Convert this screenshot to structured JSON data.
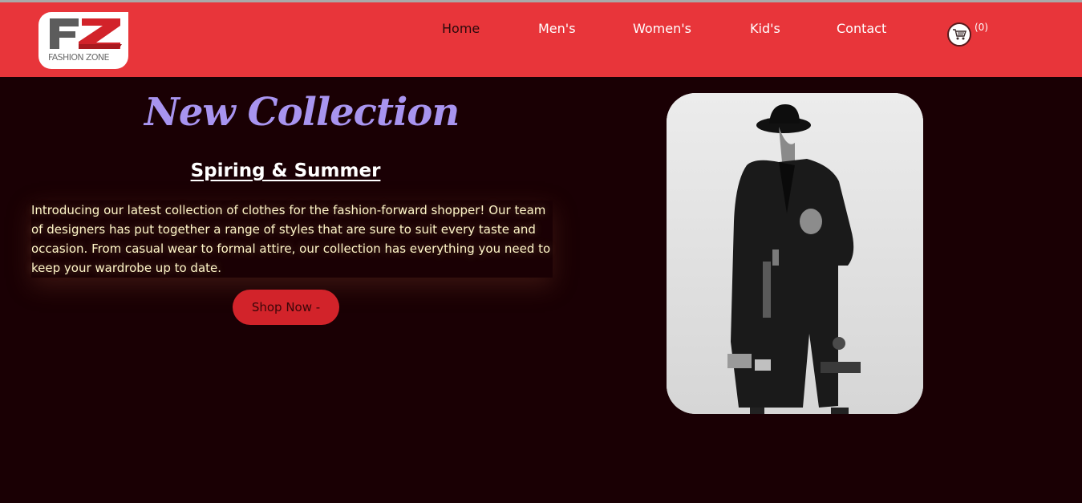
{
  "brand": {
    "logo_letters": "FZ",
    "logo_text": "FASHION ZONE",
    "colors": {
      "header": "#e8353a",
      "background": "#1a0004",
      "title": "#a894f0",
      "button": "#d2232a"
    }
  },
  "nav": {
    "items": [
      {
        "label": "Home",
        "active": true
      },
      {
        "label": "Men's",
        "active": false
      },
      {
        "label": "Women's",
        "active": false
      },
      {
        "label": "Kid's",
        "active": false
      },
      {
        "label": "Contact",
        "active": false
      }
    ],
    "cart_icon": "shopping-cart-icon",
    "cart_count": "(0)"
  },
  "hero": {
    "title": "New Collection",
    "subtitle": "Spiring & Summer",
    "intro": "Introducing our latest collection of clothes for the fashion-forward shopper! Our team of designers has put together a range of styles that are sure to suit every taste and occasion. From casual wear to formal attire, our collection has everything you need to keep your wardrobe up to date.",
    "button_label": "Shop Now -"
  }
}
